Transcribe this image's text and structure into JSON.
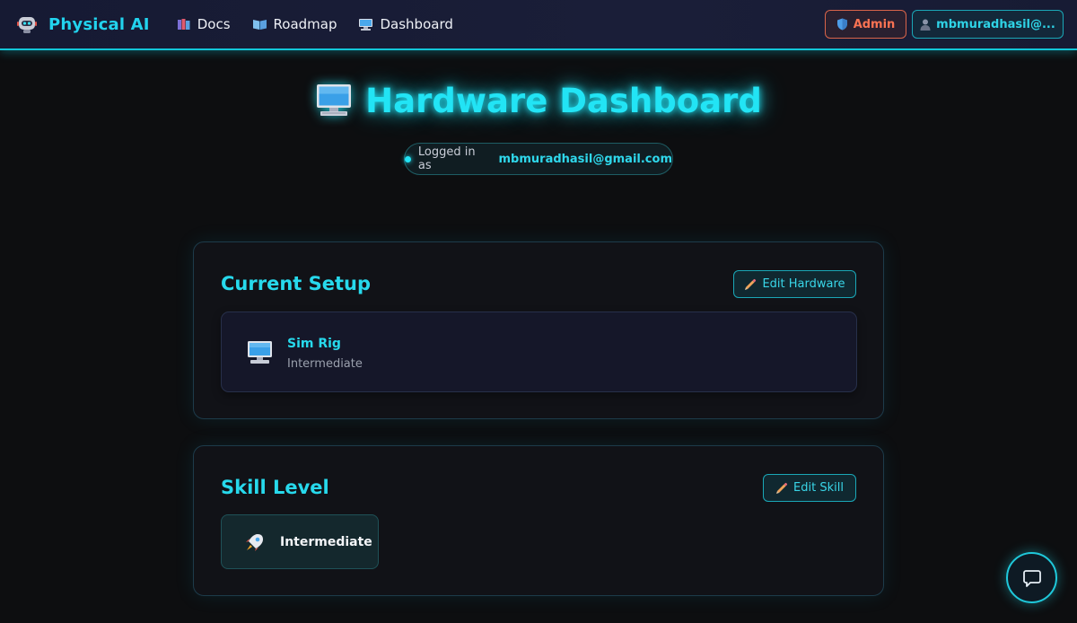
{
  "navbar": {
    "brand": "Physical AI",
    "links": [
      {
        "label": "Docs",
        "icon": "books-icon"
      },
      {
        "label": "Roadmap",
        "icon": "open-book-icon"
      },
      {
        "label": "Dashboard",
        "icon": "monitor-icon"
      }
    ],
    "admin_label": "Admin",
    "user_label": "mbmuradhasil@..."
  },
  "hero": {
    "title": "Hardware Dashboard",
    "logged_in_prefix": "Logged in as",
    "email": "mbmuradhasil@gmail.com"
  },
  "current_setup": {
    "title": "Current Setup",
    "edit_label": "Edit Hardware",
    "item": {
      "name": "Sim Rig",
      "level": "Intermediate"
    }
  },
  "skill_level": {
    "title": "Skill Level",
    "edit_label": "Edit Skill",
    "value": "Intermediate"
  },
  "colors": {
    "accent": "#22d3ee",
    "admin": "#f97353",
    "background": "#0d0e10"
  }
}
